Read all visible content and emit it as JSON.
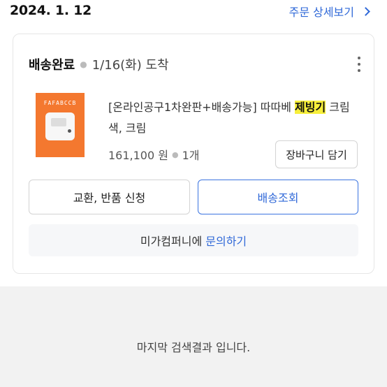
{
  "order": {
    "date": "2024. 1. 12",
    "detail_link": "주문 상세보기"
  },
  "card": {
    "status": "배송완료",
    "arrival": "1/16(화) 도착",
    "product": {
      "thumb_brand": "FAFABCCB",
      "title_before": "[온라인공구1차완판+배송가능] 따따베 ",
      "title_highlight": "제빙기",
      "title_after": " 크림색, 크림",
      "price": "161,100 원",
      "quantity": "1개"
    },
    "cart_button": "장바구니 담기",
    "exchange_button": "교환, 반품 신청",
    "tracking_button": "배송조회",
    "inquiry": {
      "seller": "미가컴퍼니에",
      "link": "문의하기"
    }
  },
  "footer": {
    "end_message": "마지막 검색결과 입니다."
  },
  "colors": {
    "accent": "#2f68d8",
    "highlight": "#f7ef3a",
    "thumbnail_bg": "#f4782f"
  }
}
